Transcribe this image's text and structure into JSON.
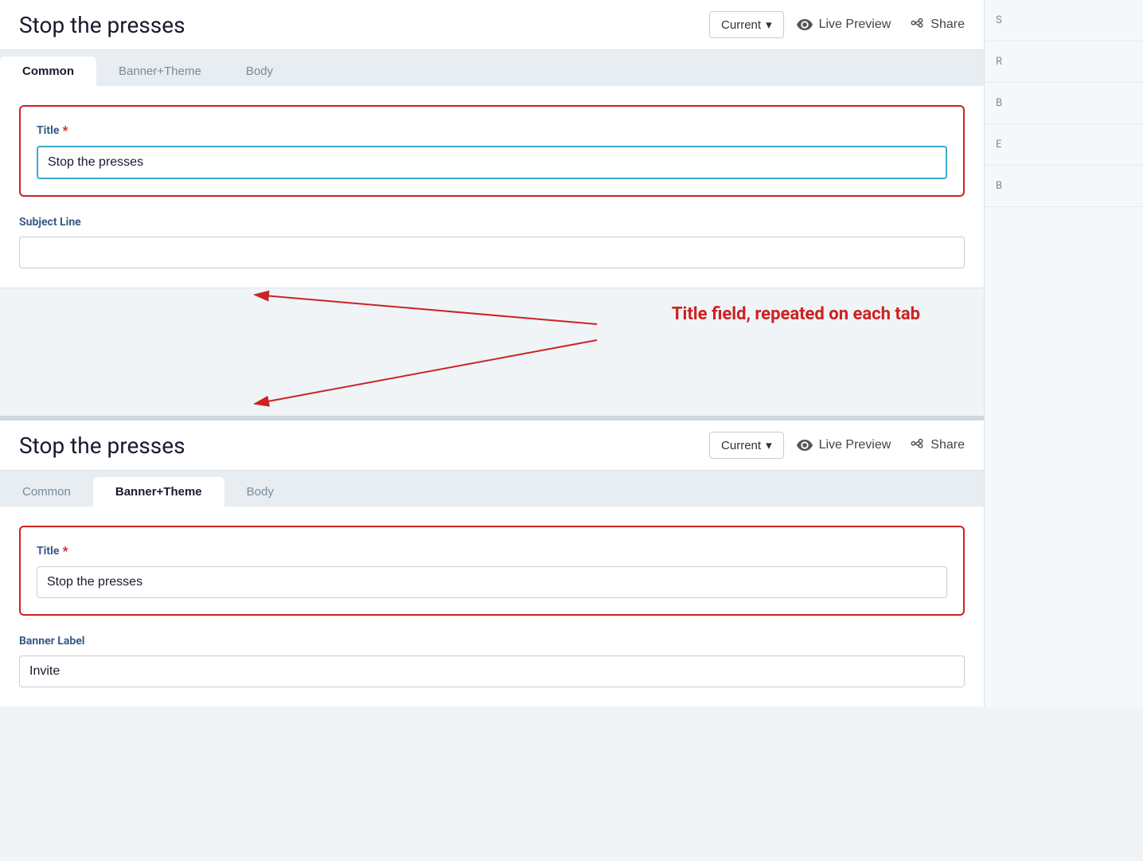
{
  "page": {
    "title": "Stop the presses",
    "version_label": "Current",
    "version_chevron": "▾",
    "live_preview_label": "Live Preview",
    "share_label": "Share"
  },
  "top_panel": {
    "tabs": [
      {
        "id": "common",
        "label": "Common",
        "active": true
      },
      {
        "id": "banner_theme",
        "label": "Banner+Theme",
        "active": false
      },
      {
        "id": "body",
        "label": "Body",
        "active": false
      }
    ],
    "title_field": {
      "label": "Title",
      "required": true,
      "value": "Stop the presses",
      "placeholder": ""
    },
    "subject_field": {
      "label": "Subject Line",
      "value": "",
      "placeholder": ""
    }
  },
  "annotation": {
    "text": "Title field, repeated on each tab"
  },
  "bottom_panel": {
    "tabs": [
      {
        "id": "common",
        "label": "Common",
        "active": false
      },
      {
        "id": "banner_theme",
        "label": "Banner+Theme",
        "active": true
      },
      {
        "id": "body",
        "label": "Body",
        "active": false
      }
    ],
    "title_field": {
      "label": "Title",
      "required": true,
      "value": "Stop the presses",
      "placeholder": ""
    },
    "banner_field": {
      "label": "Banner Label",
      "value": "Invite",
      "placeholder": ""
    }
  },
  "right_sidebar": {
    "items": [
      "S",
      "R",
      "B",
      "E",
      "B"
    ]
  }
}
